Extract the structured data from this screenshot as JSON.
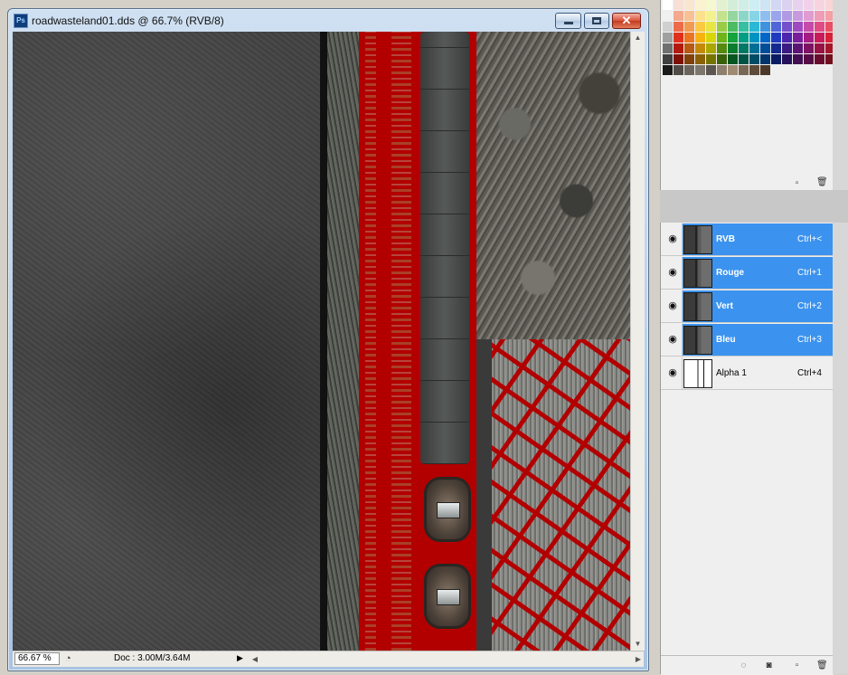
{
  "window": {
    "title": "roadwasteland01.dds @ 66.7% (RVB/8)",
    "logo": "Ps",
    "minimize_icon": "minimize-icon",
    "maximize_icon": "maximize-icon",
    "close_icon": "close-icon",
    "close_glyph": "✕"
  },
  "status_bar": {
    "zoom": "66.67 %",
    "doc_info": "Doc : 3.00M/3.64M",
    "arrow": "▶",
    "scroll_left": "◀",
    "scroll_right": "▶"
  },
  "vscroll": {
    "up": "▲",
    "down": "▼"
  },
  "swatches": {
    "rows": [
      [
        "#ffffff",
        "#f6e0d6",
        "#f8e6cf",
        "#fbf2cf",
        "#f6f8cf",
        "#e2f1cf",
        "#d3edd8",
        "#cfeee6",
        "#cdeff3",
        "#cfe4f5",
        "#d2d7f3",
        "#dbd1f0",
        "#e7d1ef",
        "#f1d1ea",
        "#f7d3df",
        "#f9d5d6"
      ],
      [
        "#f0f0f0",
        "#f4a88e",
        "#f7c193",
        "#fde08c",
        "#f3f28e",
        "#c4e28c",
        "#95d6a0",
        "#8ad7c8",
        "#85d5e7",
        "#8fbff0",
        "#9aa5ec",
        "#b09ae4",
        "#c999de",
        "#e09bd1",
        "#ee9cb8",
        "#f4a0a4"
      ],
      [
        "#d0d0d0",
        "#ee6b4a",
        "#f29a4f",
        "#fcc943",
        "#e7e642",
        "#99cc44",
        "#4dbb63",
        "#36bfa2",
        "#2ab8d6",
        "#3d93e0",
        "#4f66d8",
        "#7550cc",
        "#9f4ac0",
        "#c64aaa",
        "#e04b83",
        "#ea4e64"
      ],
      [
        "#a0a0a0",
        "#e0301c",
        "#ea7420",
        "#f7b20f",
        "#d8d60a",
        "#6fb31a",
        "#14a33d",
        "#009e85",
        "#0093c2",
        "#0066c8",
        "#1f3cc0",
        "#4c25ad",
        "#7a1e9c",
        "#a41d85",
        "#c81c5a",
        "#d9203a"
      ],
      [
        "#707070",
        "#b21a0d",
        "#b85a12",
        "#c48a06",
        "#aaa700",
        "#558a0e",
        "#0a7d2e",
        "#007866",
        "#006f95",
        "#004d9a",
        "#15298f",
        "#391b82",
        "#5c1574",
        "#7c1463",
        "#971343",
        "#a6152a"
      ],
      [
        "#404040",
        "#7e1006",
        "#82400b",
        "#8a6104",
        "#767400",
        "#3a600a",
        "#055620",
        "#005247",
        "#004c67",
        "#00356b",
        "#0c1c63",
        "#26125a",
        "#400e51",
        "#560d45",
        "#690d2f",
        "#730e1d"
      ],
      [
        "#1a1a1a",
        "#4f4a45",
        "#6a645c",
        "#7d766c",
        "#5b5550",
        "#8f7e6c",
        "#a08a72",
        "#7a6753",
        "#5d4a38",
        "#4a3828"
      ]
    ]
  },
  "channels": [
    {
      "name": "RVB",
      "shortcut": "Ctrl+<",
      "selected": true
    },
    {
      "name": "Rouge",
      "shortcut": "Ctrl+1",
      "selected": true
    },
    {
      "name": "Vert",
      "shortcut": "Ctrl+2",
      "selected": true
    },
    {
      "name": "Bleu",
      "shortcut": "Ctrl+3",
      "selected": true
    },
    {
      "name": "Alpha 1",
      "shortcut": "Ctrl+4",
      "selected": false
    }
  ],
  "icons": {
    "eye": "◉",
    "new_channel": "▫",
    "trash": "🗑",
    "load_selection": "◌",
    "save_selection": "◙",
    "history": "◔"
  }
}
